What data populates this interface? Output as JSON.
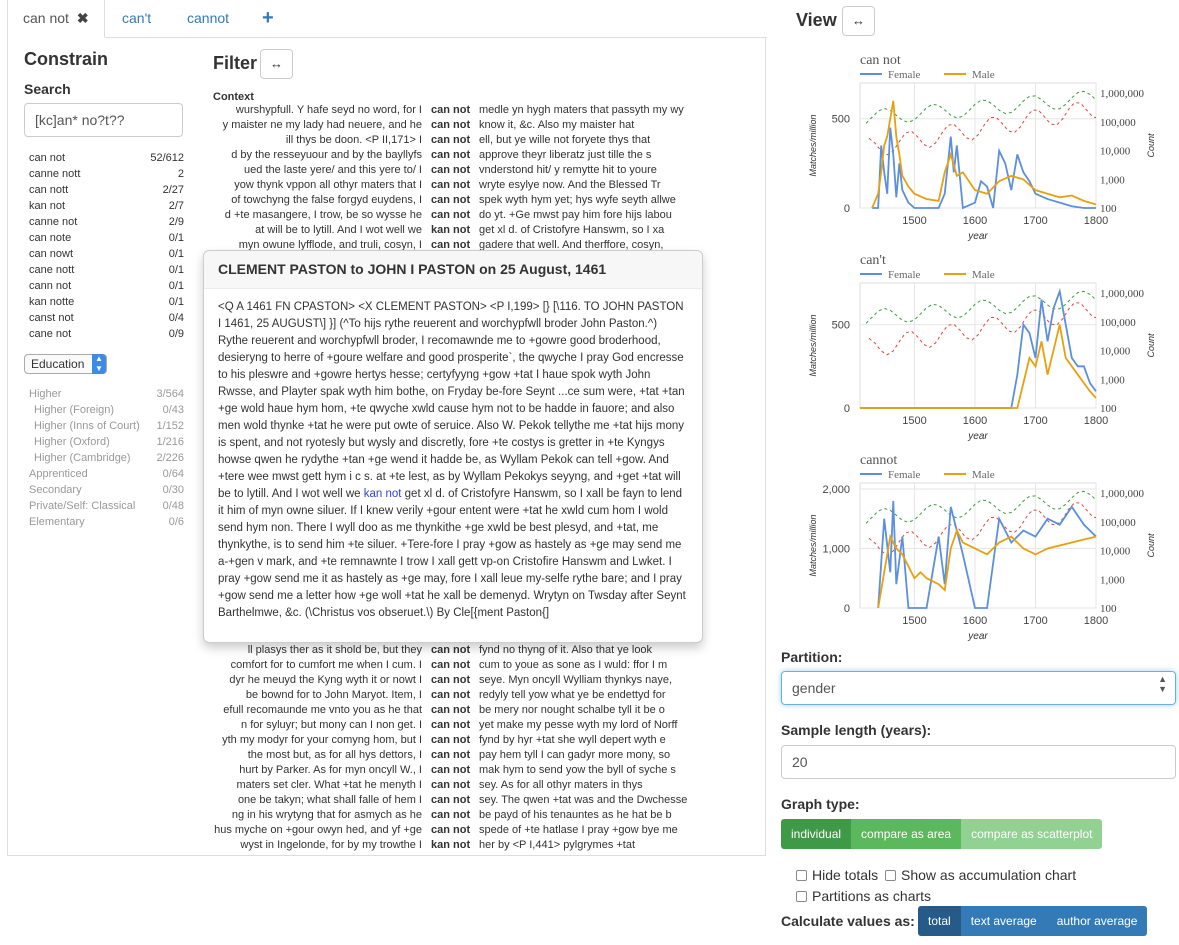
{
  "tabs": [
    {
      "label": "can not",
      "close": "✖"
    },
    {
      "label": "can't"
    },
    {
      "label": "cannot"
    },
    {
      "label": "+"
    }
  ],
  "constrain": {
    "title": "Constrain",
    "search_label": "Search",
    "search_value": "[kc]an* no?t??",
    "forms": [
      {
        "form": "can not",
        "count": "52/612"
      },
      {
        "form": "canne nott",
        "count": "2"
      },
      {
        "form": "can nott",
        "count": "2/27"
      },
      {
        "form": "kan not",
        "count": "2/7"
      },
      {
        "form": "canne not",
        "count": "2/9"
      },
      {
        "form": "can note",
        "count": "0/1"
      },
      {
        "form": "can nowt",
        "count": "0/1"
      },
      {
        "form": "cane nott",
        "count": "0/1"
      },
      {
        "form": "cann not",
        "count": "0/1"
      },
      {
        "form": "kan notte",
        "count": "0/1"
      },
      {
        "form": "canst not",
        "count": "0/4"
      },
      {
        "form": "cane not",
        "count": "0/9"
      }
    ],
    "education_select": "Education",
    "education": [
      {
        "label": "Higher",
        "count": "3/564",
        "sub": false
      },
      {
        "label": "Higher (Foreign)",
        "count": "0/43",
        "sub": true
      },
      {
        "label": "Higher (Inns of Court)",
        "count": "1/152",
        "sub": true
      },
      {
        "label": "Higher (Oxford)",
        "count": "1/216",
        "sub": true
      },
      {
        "label": "Higher (Cambridge)",
        "count": "2/226",
        "sub": true
      },
      {
        "label": "Apprenticed",
        "count": "0/64",
        "sub": false
      },
      {
        "label": "Secondary",
        "count": "0/30",
        "sub": false
      },
      {
        "label": "Private/Self: Classical",
        "count": "0/48",
        "sub": false
      },
      {
        "label": "Elementary",
        "count": "0/6",
        "sub": false
      }
    ]
  },
  "filter": {
    "title": "Filter",
    "toggle_icon": "↔",
    "context_label": "Context",
    "rows_top": [
      {
        "l": "wurshypfull. Y hafe seyd no word, for I",
        "k": "can not",
        "r": "medle yn hygh maters that passyth my wy"
      },
      {
        "l": "y maister ne my lady had neuere, and he",
        "k": "can not",
        "r": "know it, &c. Also my maister hat"
      },
      {
        "l": "ill thys be doon. <P II,171> I",
        "k": "can not",
        "r": "ell, but ye wille not foryete thys that"
      },
      {
        "l": "d by the resseyuour and by the bayllyfs",
        "k": "can not",
        "r": "approve theyr liberatz just tille the s"
      },
      {
        "l": "ued the laste yere/ and this yere to/ I",
        "k": "can not",
        "r": "vnderstond hit/ y remytte hit to youre"
      },
      {
        "l": "yow thynk vppon all othyr maters that I",
        "k": "can not",
        "r": "wryte esylye now. And the Blessed Tr"
      },
      {
        "l": "of towchyng the false forgyd euydens, I",
        "k": "can not",
        "r": "spek wyth hym yet; hys wyfe seyth allwe"
      },
      {
        "l": "d +te masangere, I trow, be so wysse he",
        "k": "can not",
        "r": "do yt. +Ge mwst pay him fore hijs labou"
      },
      {
        "l": "at will be to lytill. And I wot well we",
        "k": "kan not",
        "r": "get xl d. of Cristofyre Hanswm, so I xa"
      },
      {
        "l": "myn owune lyfflode, and truli, cosyn, I",
        "k": "can not",
        "r": "gadere that well. And therffore, cosyn,"
      }
    ],
    "rows_bottom": [
      {
        "l": "ll plasys ther as it shold be, but they",
        "k": "can not",
        "r": "fynd no thyng of it. Also that ye look"
      },
      {
        "l": "comfort for to cumfort me when I cum. I",
        "k": "can not",
        "r": "cum to youe as sone as I wuld: ffor I m"
      },
      {
        "l": "dyr he meuyd the Kyng wyth it or nowt I",
        "k": "can not",
        "r": "seye. Myn oncyll Wylliam thynkys naye,"
      },
      {
        "l": "be bownd for to John Maryot. Item, I",
        "k": "can not",
        "r": "redyly tell yow what ye be endettyd for"
      },
      {
        "l": "efull recomaunde me vnto you as he that",
        "k": "can not",
        "r": "be mery nor nought schalbe tyll it be o"
      },
      {
        "l": "n for syluyr; but mony can I non get. I",
        "k": "can not",
        "r": "yet make my pesse wyth my lord of Norff"
      },
      {
        "l": "yth my modyr for your comyng hom, but I",
        "k": "can not",
        "r": "fynd by hyr +tat she wyll depert wyth e"
      },
      {
        "l": "the most but, as for all hys dettors, I",
        "k": "can not",
        "r": "pay hem tyll I can gadyr more mony, so"
      },
      {
        "l": "hurt by Parker. As for myn oncyll W., I",
        "k": "can not",
        "r": "mak hym to send yow the byll of syche s"
      },
      {
        "l": "maters set cler. What +tat he menyth I",
        "k": "can not",
        "r": "sey. As for all othyr maters in thys"
      },
      {
        "l": "one be takyn; what shall falle of hem I",
        "k": "can not",
        "r": "sey. The qwen +tat was and the Dwchesse"
      },
      {
        "l": "ng in his wrytyng that for asmych as he",
        "k": "can not",
        "r": "be payd of his tenauntes as he hat be b"
      },
      {
        "l": "hus myche on +gour owyn hed, and yf +ge",
        "k": "can not",
        "r": "spede of +te hatlase I pray +gow bye me"
      },
      {
        "l": "wyst in Ingelonde, for by my trowthe I",
        "k": "kan not",
        "r": "her by <P I,441> pylgrymes +tat"
      }
    ]
  },
  "popover": {
    "title": "CLEMENT PASTON to JOHN I PASTON on 25 August, 1461",
    "text_before": "<Q A 1461 FN CPASTON> <X CLEMENT PASTON> <P I,199> [} [\\116. TO JOHN PASTON I 1461, 25 AUGUST\\] }] (^To hijs rythe reuerent and worchypfwll broder John Paston.^) Rythe reuerent and worchypfwll broder, I recomawnde me to +gowre good broderhood, desieryng to herre of +goure welfare and good prosperite`, the qwyche I pray God encresse to his pleswre and +gowre hertys hesse; certyfyyng +gow +tat I haue spok wyth John Rwsse, and Playter spak wyth him bothe, on Fryday be-fore Seynt ...ce sum were, +tat +tan +ge wold haue hym hom, +te qwyche xwld cause hym not to be hadde in fauore; and also men wold thynke +tat he were put owte of seruice. Also W. Pekok tellythe me +tat hijs mony is spent, and not ryotesly but wysly and discretly, fore +te costys is gretter in +te Kyngys howse qwen he rydythe +tan +ge wend it hadde be, as Wyllam Pekok can tell +gow. And +tere wee mwst gett hym i c s. at +te lest, as by Wyllam Pekokys seyyng, and +get +tat will be to lytill. And I wot well we ",
    "keyword": "kan not",
    "text_after": " get xl d. of Cristofyre Hanswm, so I xall be fayn to lend it him of myn owne siluer. If I knew verily +gour entent were +tat he xwld cum hom I wold send hym non. There I wyll doo as me thynkithe +ge xwld be best plesyd, and +tat, me thynkythe, is to send him +te siluer. +Tere-fore I pray +gow as hastely as +ge may send me a-+gen v mark, and +te remnawnte I trow I xall gett vp-on Cristofire Hanswm and Lwket. I pray +gow send me it as hastely as +ge may, fore I xall leue my-selfe rythe bare; and I pray +gow send me a letter how +ge woll +tat he xall be demenyd. Wrytyn on Twsday after Seynt Barthelmwe, &c. (\\Christus vos obseruet.\\) By Cle[{ment Paston{]"
  },
  "view": {
    "title": "View",
    "toggle_icon": "↔"
  },
  "controls": {
    "partition_label": "Partition:",
    "partition_value": "gender",
    "sample_label": "Sample length (years):",
    "sample_value": "20",
    "graph_type_label": "Graph type:",
    "graph_types": [
      "individual",
      "compare as area",
      "compare as scatterplot"
    ],
    "hide_totals": "Hide totals",
    "accumulation": "Show as accumulation chart",
    "partitions_charts": "Partitions as charts",
    "calc_label": "Calculate values as:",
    "calc_options": [
      "total",
      "text average",
      "author average"
    ]
  },
  "colors": {
    "female": "#5b8fdf",
    "male": "#e8a010",
    "female_total": "#3a9d3a",
    "male_total": "#e0463a"
  },
  "chart_data": [
    {
      "type": "line",
      "title": "can not",
      "xlabel": "year",
      "ylabel": "Matches/million",
      "y2label": "Count",
      "xlim": [
        1410,
        1800
      ],
      "ylim": [
        0,
        700
      ],
      "y2_log": true,
      "y2lim": [
        100,
        1000000
      ],
      "x_ticks": [
        1500,
        1600,
        1700,
        1800
      ],
      "y_ticks": [
        0,
        500
      ],
      "y2_ticks": [
        "100",
        "1,000",
        "10,000",
        "100,000",
        "1,000,000"
      ],
      "legend": [
        "Female",
        "Male"
      ],
      "grid": true,
      "series": [
        {
          "name": "Female",
          "x": [
            1430,
            1440,
            1445,
            1450,
            1455,
            1460,
            1465,
            1470,
            1475,
            1480,
            1490,
            1500,
            1520,
            1540,
            1550,
            1560,
            1565,
            1570,
            1580,
            1600,
            1610,
            1620,
            1630,
            1640,
            1650,
            1660,
            1670,
            1680,
            1690,
            1700,
            1720,
            1740,
            1760,
            1780,
            1800
          ],
          "y": [
            0,
            0,
            350,
            200,
            80,
            450,
            300,
            60,
            250,
            100,
            30,
            0,
            0,
            0,
            80,
            400,
            200,
            350,
            0,
            30,
            150,
            120,
            0,
            320,
            250,
            100,
            300,
            200,
            150,
            80,
            50,
            30,
            10,
            0,
            0
          ]
        },
        {
          "name": "Male",
          "x": [
            1430,
            1440,
            1445,
            1450,
            1455,
            1460,
            1465,
            1470,
            1475,
            1480,
            1490,
            1500,
            1520,
            1540,
            1550,
            1560,
            1570,
            1580,
            1600,
            1620,
            1640,
            1660,
            1680,
            1700,
            1720,
            1740,
            1760,
            1780,
            1800
          ],
          "y": [
            0,
            80,
            200,
            350,
            400,
            500,
            600,
            400,
            300,
            180,
            120,
            80,
            50,
            40,
            200,
            300,
            180,
            200,
            100,
            80,
            150,
            180,
            160,
            100,
            80,
            60,
            70,
            40,
            20
          ]
        }
      ]
    },
    {
      "type": "line",
      "title": "can't",
      "xlabel": "year",
      "ylabel": "Matches/million",
      "y2label": "Count",
      "xlim": [
        1410,
        1800
      ],
      "ylim": [
        0,
        750
      ],
      "y2_log": true,
      "y2lim": [
        100,
        1000000
      ],
      "x_ticks": [
        1500,
        1600,
        1700,
        1800
      ],
      "y_ticks": [
        0,
        500
      ],
      "y2_ticks": [
        "100",
        "1,000",
        "10,000",
        "100,000",
        "1,000,000"
      ],
      "legend": [
        "Female",
        "Male"
      ],
      "grid": true,
      "series": [
        {
          "name": "Female",
          "x": [
            1410,
            1600,
            1660,
            1670,
            1680,
            1690,
            1700,
            1710,
            1720,
            1730,
            1740,
            1750,
            1760,
            1770,
            1780,
            1790,
            1800
          ],
          "y": [
            0,
            0,
            0,
            200,
            500,
            450,
            300,
            650,
            400,
            600,
            700,
            500,
            300,
            250,
            250,
            150,
            100
          ]
        },
        {
          "name": "Male",
          "x": [
            1410,
            1600,
            1670,
            1680,
            1690,
            1700,
            1710,
            1720,
            1730,
            1740,
            1750,
            1760,
            1770,
            1780,
            1790,
            1800
          ],
          "y": [
            0,
            0,
            0,
            150,
            300,
            250,
            400,
            200,
            350,
            500,
            300,
            250,
            200,
            150,
            100,
            60
          ]
        }
      ]
    },
    {
      "type": "line",
      "title": "cannot",
      "xlabel": "year",
      "ylabel": "Matches/million",
      "y2label": "Count",
      "xlim": [
        1410,
        1800
      ],
      "ylim": [
        0,
        2100
      ],
      "y2_log": true,
      "y2lim": [
        100,
        1000000
      ],
      "x_ticks": [
        1500,
        1600,
        1700,
        1800
      ],
      "y_ticks": [
        0,
        1000,
        2000
      ],
      "y2_ticks": [
        "100",
        "1,000",
        "10,000",
        "100,000",
        "1,000,000"
      ],
      "legend": [
        "Female",
        "Male"
      ],
      "grid": true,
      "series": [
        {
          "name": "Female",
          "x": [
            1440,
            1450,
            1460,
            1465,
            1470,
            1480,
            1490,
            1500,
            1520,
            1540,
            1550,
            1560,
            1570,
            1580,
            1600,
            1620,
            1640,
            1660,
            1680,
            1700,
            1720,
            1740,
            1760,
            1780,
            1790,
            1800
          ],
          "y": [
            0,
            1500,
            600,
            1800,
            400,
            1200,
            0,
            0,
            0,
            1200,
            400,
            1700,
            1300,
            900,
            0,
            0,
            1500,
            1100,
            1300,
            1200,
            1500,
            1400,
            1700,
            1400,
            1300,
            1200
          ]
        },
        {
          "name": "Male",
          "x": [
            1440,
            1450,
            1460,
            1470,
            1480,
            1490,
            1500,
            1510,
            1520,
            1540,
            1550,
            1560,
            1570,
            1580,
            1600,
            1620,
            1640,
            1660,
            1680,
            1700,
            1720,
            1740,
            1760,
            1780,
            1800
          ],
          "y": [
            0,
            600,
            1200,
            1000,
            900,
            700,
            500,
            600,
            500,
            400,
            300,
            1000,
            1300,
            1100,
            1000,
            900,
            1100,
            1200,
            1000,
            900,
            1000,
            1050,
            1100,
            1150,
            1200
          ]
        }
      ]
    }
  ]
}
